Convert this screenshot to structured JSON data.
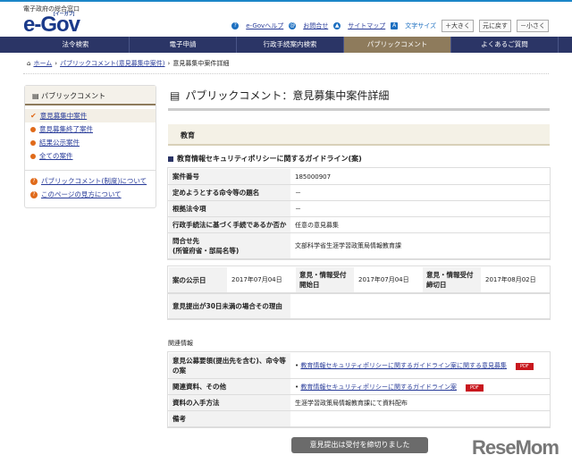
{
  "header": {
    "tagline": "電子政府の総合窓口",
    "logo": "e-Gov",
    "logo_sub": "[イーガブ]",
    "util": {
      "help": "e-Govヘルプ",
      "contact": "お問合せ",
      "sitemap": "サイトマップ",
      "font_size": "文字サイズ",
      "larger": "＋大きく",
      "reset": "元に戻す",
      "smaller": "－小さく"
    }
  },
  "nav": [
    {
      "label": "法令検索"
    },
    {
      "label": "電子申請"
    },
    {
      "label": "行政手続案内検索"
    },
    {
      "label": "パブリックコメント",
      "active": true
    },
    {
      "label": "よくあるご質問"
    }
  ],
  "breadcrumb": {
    "home": "ホーム",
    "parent": "パブリックコメント(意見募集中案件)",
    "current": "意見募集中案件詳細"
  },
  "sidebar": {
    "title": "パブリックコメント",
    "items": [
      {
        "label": "意見募集中案件"
      },
      {
        "label": "意見募集終了案件"
      },
      {
        "label": "結果公示案件"
      },
      {
        "label": "全ての案件"
      }
    ],
    "help": [
      {
        "label": "パブリックコメント(制度)について"
      },
      {
        "label": "このページの見方について"
      }
    ]
  },
  "main": {
    "title": "パブリックコメント：意見募集中案件詳細",
    "category": "教育",
    "subject": "教育情報セキュリティポリシーに関するガイドライン(案)",
    "rows": [
      {
        "label": "案件番号",
        "value": "185000907"
      },
      {
        "label": "定めようとする命令等の題名",
        "value": "－"
      },
      {
        "label": "根拠法令項",
        "value": "－"
      },
      {
        "label": "行政手続法に基づく手続であるか否か",
        "value": "任意の意見募集"
      },
      {
        "label": "問合せ先\n(所管府省・部局名等)",
        "value": "文部科学省生涯学習政策局情報教育課"
      }
    ],
    "dates": {
      "pub_label": "案の公示日",
      "pub": "2017年07月04日",
      "start_label": "意見・情報受付開始日",
      "start": "2017年07月04日",
      "end_label": "意見・情報受付締切日",
      "end": "2017年08月02日"
    },
    "reason_label": "意見提出が30日未満の場合その理由",
    "reason": "",
    "related_title": "関連情報",
    "related": [
      {
        "label": "意見公募要領(提出先を含む)、命令等の案",
        "link": "教育情報セキュリティポリシーに関するガイドライン案に関する意見募集",
        "badge": "PDF"
      },
      {
        "label": "関連資料、その他",
        "link": "教育情報セキュリティポリシーに関するガイドライン案",
        "badge": "PDF"
      },
      {
        "label": "資料の入手方法",
        "value": "生涯学習政策局情報教育課にて資料配布"
      },
      {
        "label": "備考",
        "value": ""
      }
    ],
    "closed_button": "意見提出は受付を締切りました"
  },
  "watermark": "ReseMom"
}
